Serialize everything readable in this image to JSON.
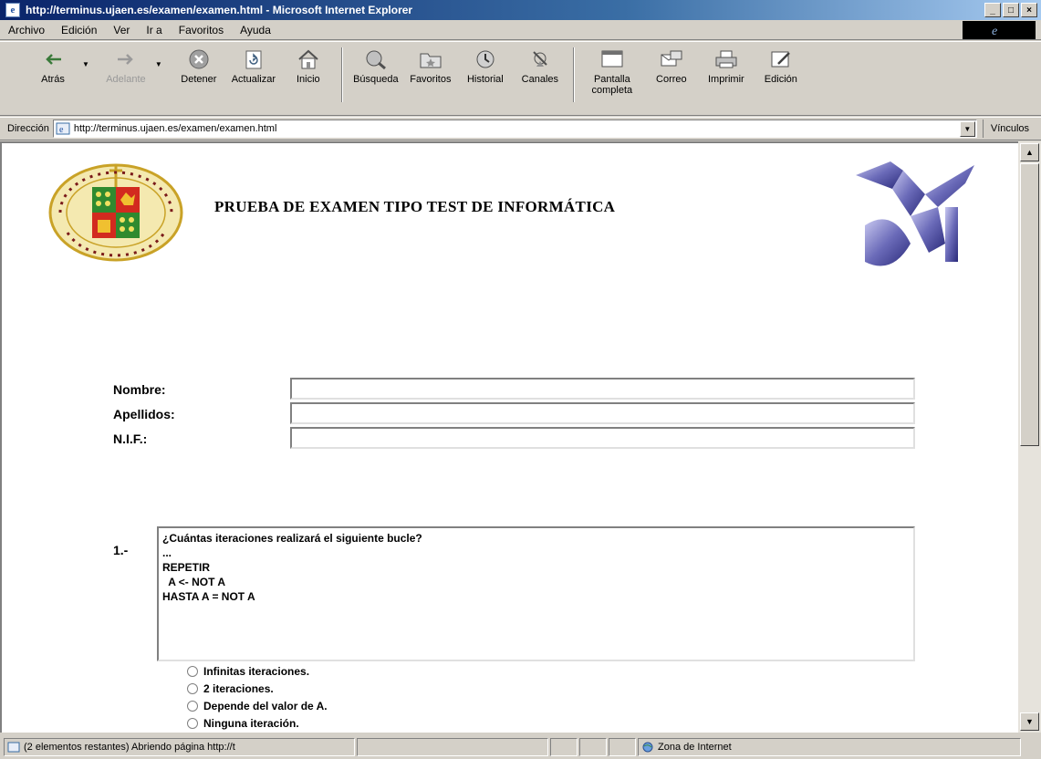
{
  "window": {
    "title": "http://terminus.ujaen.es/examen/examen.html - Microsoft Internet Explorer",
    "controls": [
      "_",
      "□",
      "×"
    ]
  },
  "menu": [
    "Archivo",
    "Edición",
    "Ver",
    "Ir a",
    "Favoritos",
    "Ayuda"
  ],
  "toolbar": {
    "back": "Atrás",
    "forward": "Adelante",
    "stop": "Detener",
    "refresh": "Actualizar",
    "home": "Inicio",
    "search": "Búsqueda",
    "favorites": "Favoritos",
    "history": "Historial",
    "channels": "Canales",
    "fullscreen": "Pantalla completa",
    "mail": "Correo",
    "print": "Imprimir",
    "edit": "Edición"
  },
  "address": {
    "label": "Dirección",
    "url": "http://terminus.ujaen.es/examen/examen.html",
    "links": "Vínculos"
  },
  "page": {
    "heading": "PRUEBA DE EXAMEN TIPO TEST DE INFORMÁTICA",
    "form": {
      "name_label": "Nombre:",
      "surname_label": "Apellidos:",
      "nif_label": "N.I.F.:"
    },
    "question": {
      "number": "1.-",
      "lines": [
        "¿Cuántas iteraciones realizará el siguiente bucle?",
        "",
        "...",
        "REPETIR",
        "  A <- NOT A",
        "HASTA A = NOT A"
      ],
      "options": [
        "Infinitas iteraciones.",
        "2 iteraciones.",
        "Depende del valor de A.",
        "Ninguna iteración."
      ]
    }
  },
  "status": {
    "message": "(2 elementos restantes) Abriendo página http://t",
    "zone": "Zona de Internet"
  }
}
